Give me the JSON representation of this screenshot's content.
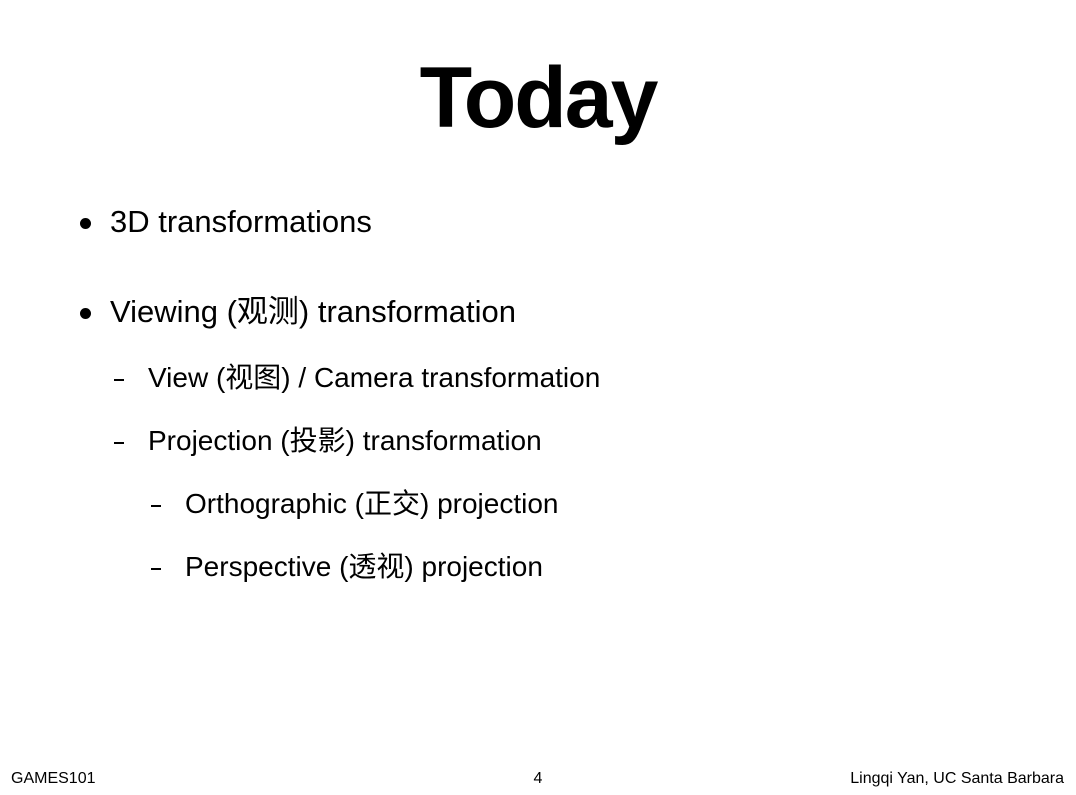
{
  "slide": {
    "title": "Today",
    "bullets": [
      {
        "text": "3D transformations",
        "level": 1
      },
      {
        "text": "Viewing (观测) transformation",
        "level": 1
      },
      {
        "text": "View (视图) / Camera transformation",
        "level": 2
      },
      {
        "text": "Projection (投影) transformation",
        "level": 2
      },
      {
        "text": "Orthographic (正交) projection",
        "level": 3
      },
      {
        "text": "Perspective (透视) projection",
        "level": 3
      }
    ]
  },
  "footer": {
    "course": "GAMES101",
    "page_number": "4",
    "author": "Lingqi Yan, UC Santa Barbara"
  }
}
